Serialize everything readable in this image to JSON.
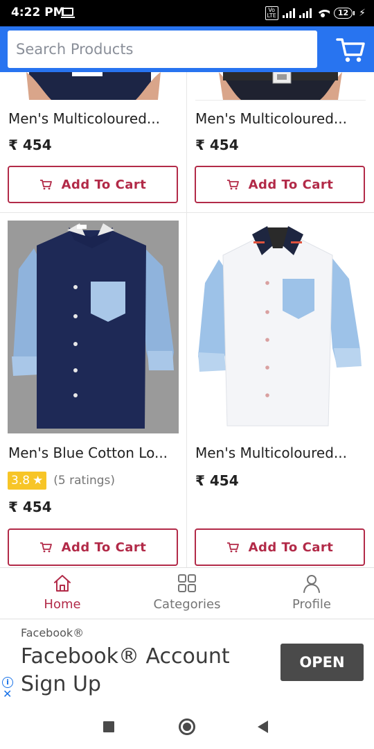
{
  "status_bar": {
    "time": "4:22 PM",
    "volte_label": "Vo\nLTE",
    "battery_level": "12",
    "icons": [
      "cast-icon",
      "volte-icon",
      "signal-icon",
      "signal-icon",
      "wifi-icon",
      "battery-icon",
      "charging-icon"
    ]
  },
  "header": {
    "search_placeholder": "Search Products",
    "cart_icon": "cart-icon",
    "background_color": "#2874f0"
  },
  "products": [
    {
      "title": "Men's Multicoloured...",
      "price": "₹ 454",
      "button_label": "Add To Cart"
    },
    {
      "title": "Men's Multicoloured...",
      "price": "₹ 454",
      "button_label": "Add To Cart"
    },
    {
      "title": "Men's Blue Cotton Lo...",
      "rating": "3.8",
      "ratings_count": "(5 ratings)",
      "price": "₹ 454",
      "button_label": "Add To Cart"
    },
    {
      "title": "Men's Multicoloured...",
      "price": "₹ 454",
      "button_label": "Add To Cart"
    }
  ],
  "bottom_nav": {
    "items": [
      {
        "label": "Home",
        "icon": "home-icon",
        "active": true
      },
      {
        "label": "Categories",
        "icon": "categories-icon",
        "active": false
      },
      {
        "label": "Profile",
        "icon": "profile-icon",
        "active": false
      }
    ],
    "active_color": "#b22a48",
    "inactive_color": "#757575"
  },
  "ad": {
    "source": "Facebook®",
    "headline": "Facebook® Account Sign Up",
    "button_label": "OPEN"
  },
  "colors": {
    "accent": "#b22a48",
    "header_blue": "#2874f0",
    "rating_yellow": "#f7c527"
  }
}
